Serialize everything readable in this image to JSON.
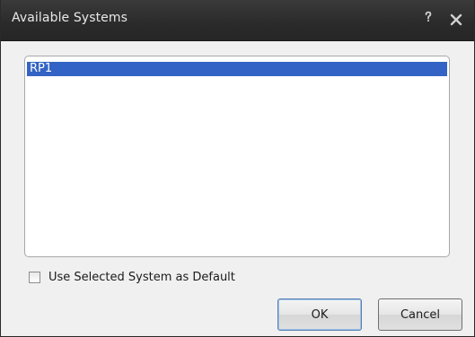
{
  "dialog": {
    "title": "Available Systems",
    "help_icon": "help-icon",
    "close_icon": "close-icon"
  },
  "systems_list": {
    "items": [
      {
        "label": "RP1",
        "selected": true
      }
    ]
  },
  "default_checkbox": {
    "label": "Use Selected System as Default",
    "checked": false
  },
  "buttons": {
    "ok_label": "OK",
    "cancel_label": "Cancel"
  },
  "colors": {
    "titlebar": "#2a2a2a",
    "selection": "#3363c4"
  }
}
